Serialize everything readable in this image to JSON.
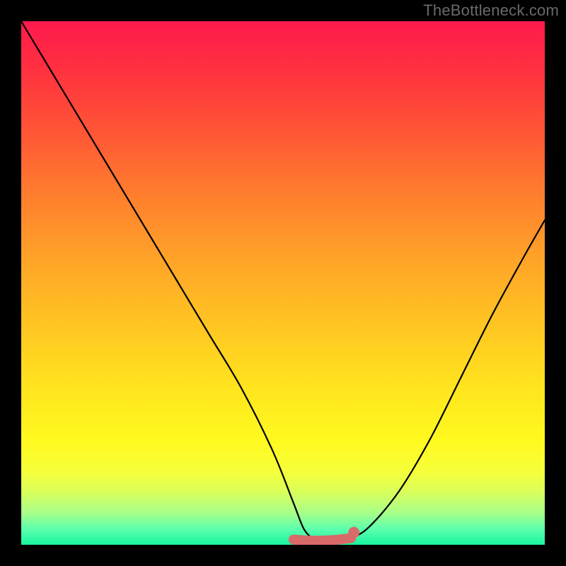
{
  "watermark": "TheBottleneck.com",
  "chart_data": {
    "type": "line",
    "title": "",
    "xlabel": "",
    "ylabel": "",
    "xlim": [
      0,
      100
    ],
    "ylim": [
      0,
      100
    ],
    "series": [
      {
        "name": "bottleneck-curve",
        "x": [
          0,
          6,
          12,
          18,
          24,
          30,
          36,
          42,
          48,
          52,
          54,
          56,
          58,
          60,
          62,
          66,
          72,
          78,
          84,
          90,
          96,
          100
        ],
        "values": [
          100,
          90,
          80,
          70,
          60,
          50,
          40,
          30,
          18,
          8,
          3,
          1,
          0,
          0,
          1,
          3,
          10,
          20,
          32,
          44,
          55,
          62
        ]
      }
    ],
    "highlight": {
      "name": "minimum-flat-region",
      "x_start": 52,
      "x_end": 63,
      "value": 1
    },
    "gradient_stops": [
      {
        "pct": 0,
        "color": "#ff1a4d"
      },
      {
        "pct": 20,
        "color": "#ff5236"
      },
      {
        "pct": 45,
        "color": "#ffa228"
      },
      {
        "pct": 70,
        "color": "#ffe41e"
      },
      {
        "pct": 90,
        "color": "#d9ff5c"
      },
      {
        "pct": 100,
        "color": "#17f59e"
      }
    ]
  }
}
